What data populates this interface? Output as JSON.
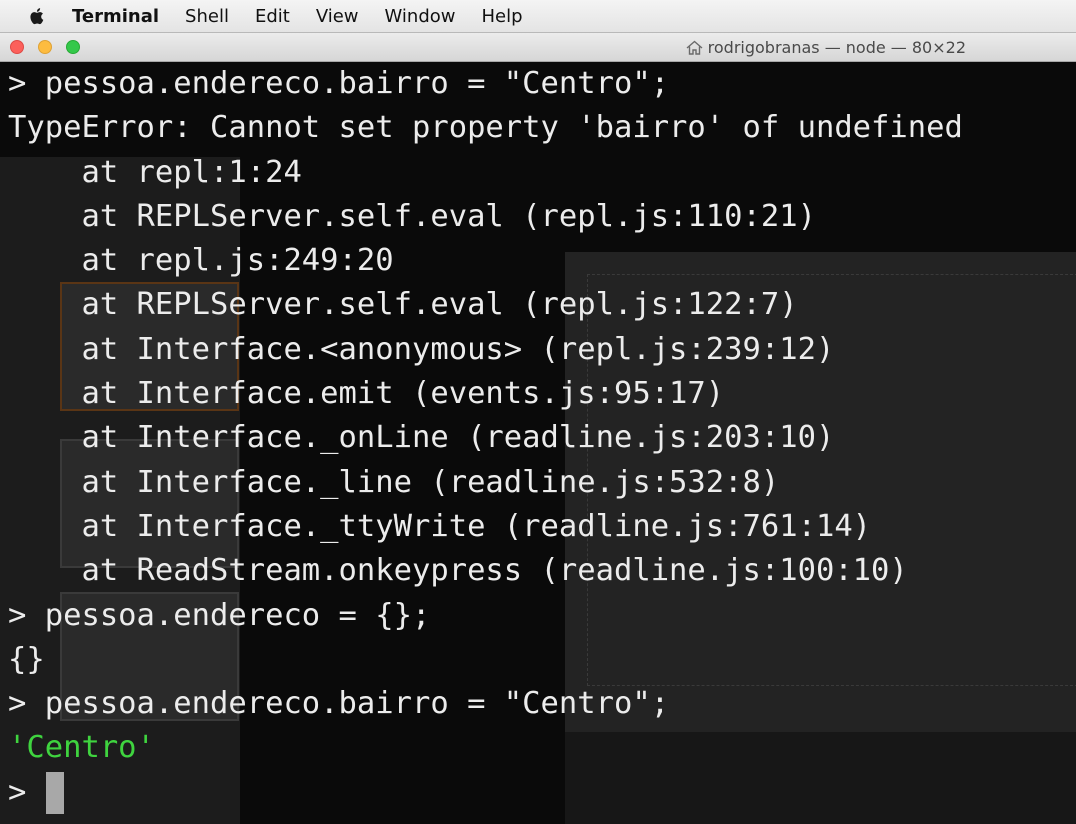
{
  "menubar": {
    "apple_icon": "apple-logo-icon",
    "items": [
      "Terminal",
      "Shell",
      "Edit",
      "View",
      "Window",
      "Help"
    ]
  },
  "window": {
    "title": "rodrigobranas — node — 80×22",
    "title_icon": "home-icon",
    "traffic_lights": {
      "close": "#fc605b",
      "minimize": "#fdbc40",
      "zoom": "#34c84a"
    }
  },
  "terminal": {
    "lines": [
      {
        "text": "> pessoa.endereco.bairro = \"Centro\";",
        "color": "default"
      },
      {
        "text": "TypeError: Cannot set property 'bairro' of undefined",
        "color": "default"
      },
      {
        "text": "    at repl:1:24",
        "color": "default"
      },
      {
        "text": "    at REPLServer.self.eval (repl.js:110:21)",
        "color": "default"
      },
      {
        "text": "    at repl.js:249:20",
        "color": "default"
      },
      {
        "text": "    at REPLServer.self.eval (repl.js:122:7)",
        "color": "default"
      },
      {
        "text": "    at Interface.<anonymous> (repl.js:239:12)",
        "color": "default"
      },
      {
        "text": "    at Interface.emit (events.js:95:17)",
        "color": "default"
      },
      {
        "text": "    at Interface._onLine (readline.js:203:10)",
        "color": "default"
      },
      {
        "text": "    at Interface._line (readline.js:532:8)",
        "color": "default"
      },
      {
        "text": "    at Interface._ttyWrite (readline.js:761:14)",
        "color": "default"
      },
      {
        "text": "    at ReadStream.onkeypress (readline.js:100:10)",
        "color": "default"
      },
      {
        "text": "> pessoa.endereco = {};",
        "color": "default"
      },
      {
        "text": "{}",
        "color": "default"
      },
      {
        "text": "> pessoa.endereco.bairro = \"Centro\";",
        "color": "default"
      },
      {
        "text": "'Centro'",
        "color": "green"
      }
    ],
    "prompt": ">",
    "colors": {
      "foreground": "#ececec",
      "string": "#3fd43f",
      "background": "#0a0a0a",
      "cursor": "#a8a8a8"
    }
  }
}
